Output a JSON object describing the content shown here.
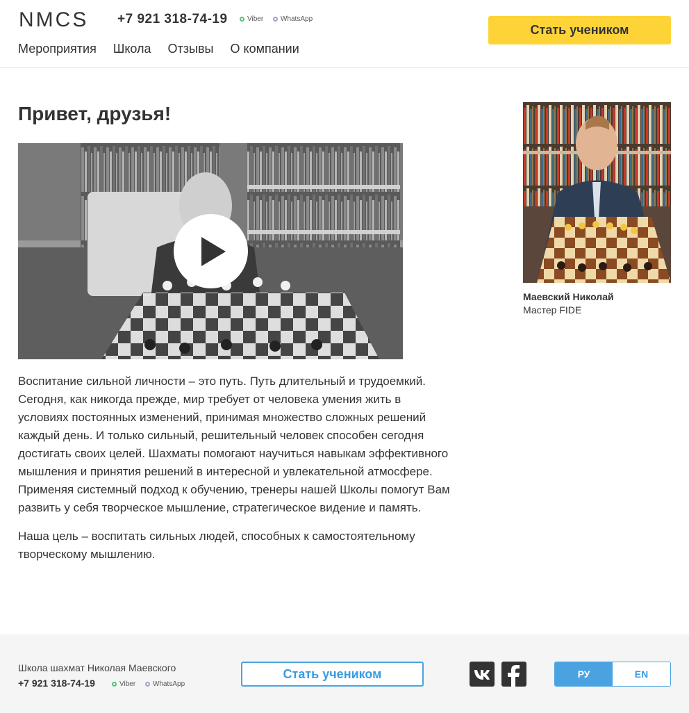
{
  "header": {
    "logo": "NMCS",
    "phone": "+7 921 318-74-19",
    "messengers": {
      "viber": "Viber",
      "whatsapp": "WhatsApp"
    },
    "cta": "Стать учеником",
    "nav": [
      "Мероприятия",
      "Школа",
      "Отзывы",
      "О компании"
    ]
  },
  "main": {
    "greeting": "Привет, друзья!",
    "paragraphs": [
      "Воспитание сильной личности – это путь. Путь длительный и трудоемкий. Сегодня, как никогда прежде, мир требует от человека умения жить в условиях постоянных изменений, принимая множество сложных решений каждый день. И только сильный, решительный человек способен сегодня достигать своих целей. Шахматы помогают научиться навыкам эффективного мышления и принятия решений в интересной и увлекательной атмосфере. Применяя системный подход к обучению, тренеры нашей Школы помогут Вам развить у себя творческое мышление, стратегическое видение и память.",
      "Наша цель – воспитать сильных людей, способных к самостоятельному творческому мышлению."
    ],
    "coach": {
      "name": "Маевский Николай",
      "title": "Мастер FIDE"
    }
  },
  "footer": {
    "school": "Школа шахмат Николая Маевского",
    "phone": "+7 921 318-74-19",
    "messengers": {
      "viber": "Viber",
      "whatsapp": "WhatsApp"
    },
    "cta": "Стать учеником",
    "languages": [
      "РУ",
      "EN"
    ],
    "active_language": "РУ"
  },
  "colors": {
    "accent_yellow": "#fed338",
    "accent_blue": "#4aa3e0",
    "text": "#333333"
  },
  "icons": [
    "play-icon",
    "vk-icon",
    "facebook-icon"
  ]
}
